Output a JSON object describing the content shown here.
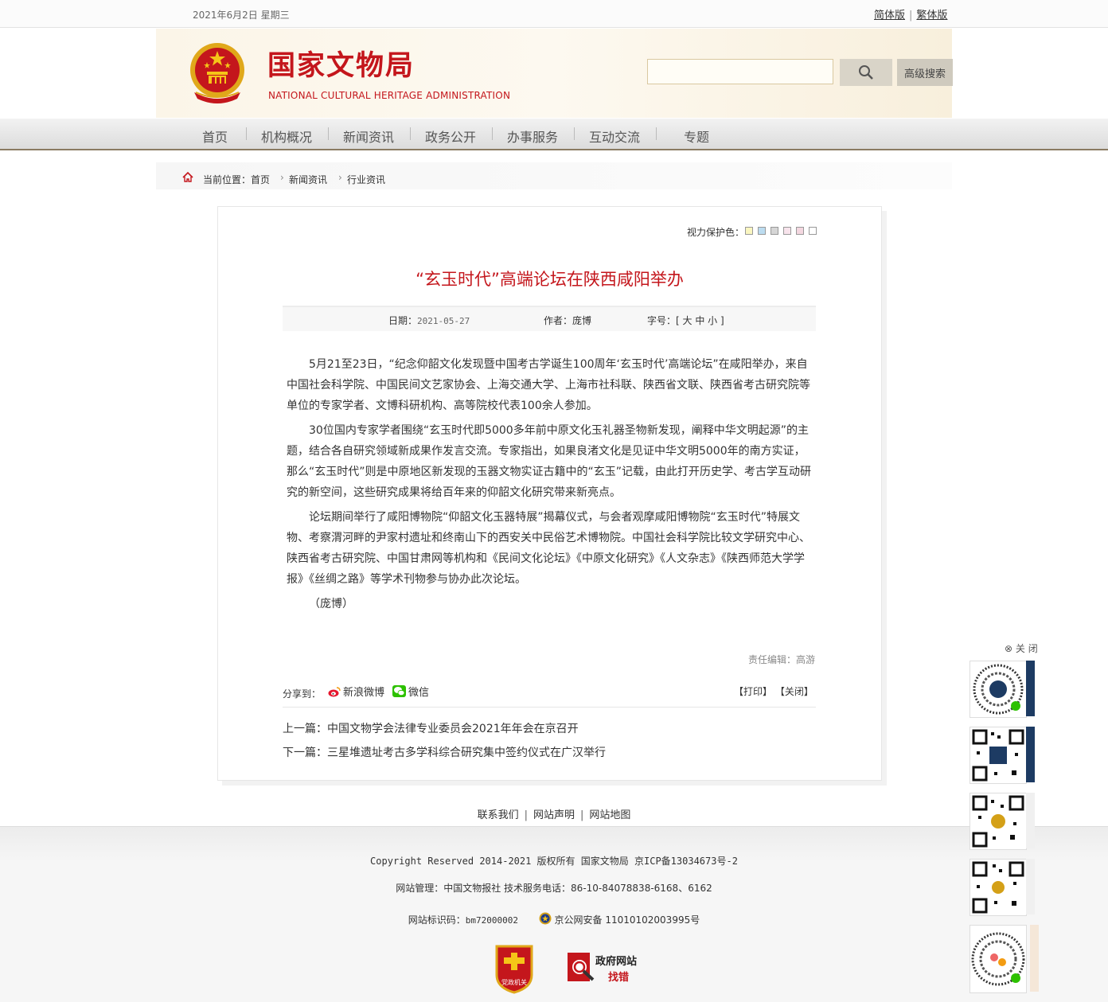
{
  "topbar": {
    "date": "2021年6月2日  星期三",
    "simplified": "简体版",
    "traditional": "繁体版"
  },
  "header": {
    "site_name": "国家文物局",
    "site_name_en": "NATIONAL CULTURAL HERITAGE ADMINISTRATION",
    "search_placeholder": "",
    "advanced_search": "高级搜索"
  },
  "nav": {
    "items": [
      "首页",
      "机构概况",
      "新闻资讯",
      "政务公开",
      "办事服务",
      "互动交流",
      "专题"
    ]
  },
  "breadcrumb": {
    "label": "当前位置：",
    "items": [
      "首页",
      "新闻资讯",
      "行业资讯"
    ]
  },
  "article": {
    "vision_label": "视力保护色：",
    "vision_colors": [
      "#faf6c0",
      "#bcdcf0",
      "#d6d6d6",
      "#f8e4ec",
      "#f4d7e0",
      "#ffffff"
    ],
    "title": "“玄玉时代”高端论坛在陕西咸阳举办",
    "date_label": "日期：",
    "date": "2021-05-27",
    "author_label": "作者：",
    "author": "庞博",
    "font_label": "字号：",
    "font_sizes": "[ 大  中  小 ]",
    "paragraphs": [
      "5月21至23日，“纪念仰韶文化发现暨中国考古学诞生100周年‘玄玉时代’高端论坛”在咸阳举办，来自中国社会科学院、中国民间文艺家协会、上海交通大学、上海市社科联、陕西省文联、陕西省考古研究院等单位的专家学者、文博科研机构、高等院校代表100余人参加。",
      "30位国内专家学者围绕“玄玉时代即5000多年前中原文化玉礼器圣物新发现，阐释中华文明起源”的主题，结合各自研究领域新成果作发言交流。专家指出，如果良渚文化是见证中华文明5000年的南方实证，那么“玄玉时代”则是中原地区新发现的玉器文物实证古籍中的“玄玉”记载，由此打开历史学、考古学互动研究的新空间，这些研究成果将给百年来的仰韶文化研究带来新亮点。",
      "论坛期间举行了咸阳博物院“仰韶文化玉器特展”揭幕仪式，与会者观摩咸阳博物院“玄玉时代”特展文物、考察渭河畔的尹家村遗址和终南山下的西安关中民俗艺术博物院。中国社会科学院比较文学研究中心、陕西省考古研究院、中国甘肃网等机构和《民间文化论坛》《中原文化研究》《人文杂志》《陕西师范大学学报》《丝绸之路》等学术刊物参与协办此次论坛。",
      "（庞博）"
    ],
    "editor": "责任编辑：高游",
    "share_label": "分享到：",
    "share_weibo": "新浪微博",
    "share_wechat": "微信",
    "print": "【打印】",
    "close": "【关闭】",
    "prev_label": "上一篇：",
    "prev_title": "中国文物学会法律专业委员会2021年年会在京召开",
    "next_label": "下一篇：",
    "next_title": "三星堆遗址考古多学科综合研究集中签约仪式在广汉举行"
  },
  "footer": {
    "links": [
      "联系我们",
      "网站声明",
      "网站地图"
    ],
    "copyright": "Copyright Reserved 2014-2021 版权所有 国家文物局 京ICP备13034673号-2",
    "manager": "网站管理：中国文物报社   技术服务电话：86-10-84078838-6168、6162",
    "site_id_label": "网站标识码：",
    "site_id": "bm72000002",
    "police": "京公网安备 11010102003995号",
    "badge_party": "党政机关",
    "gov_error_title": "政府网站",
    "gov_error_sub": "找错"
  },
  "side": {
    "close": "关 闭"
  }
}
